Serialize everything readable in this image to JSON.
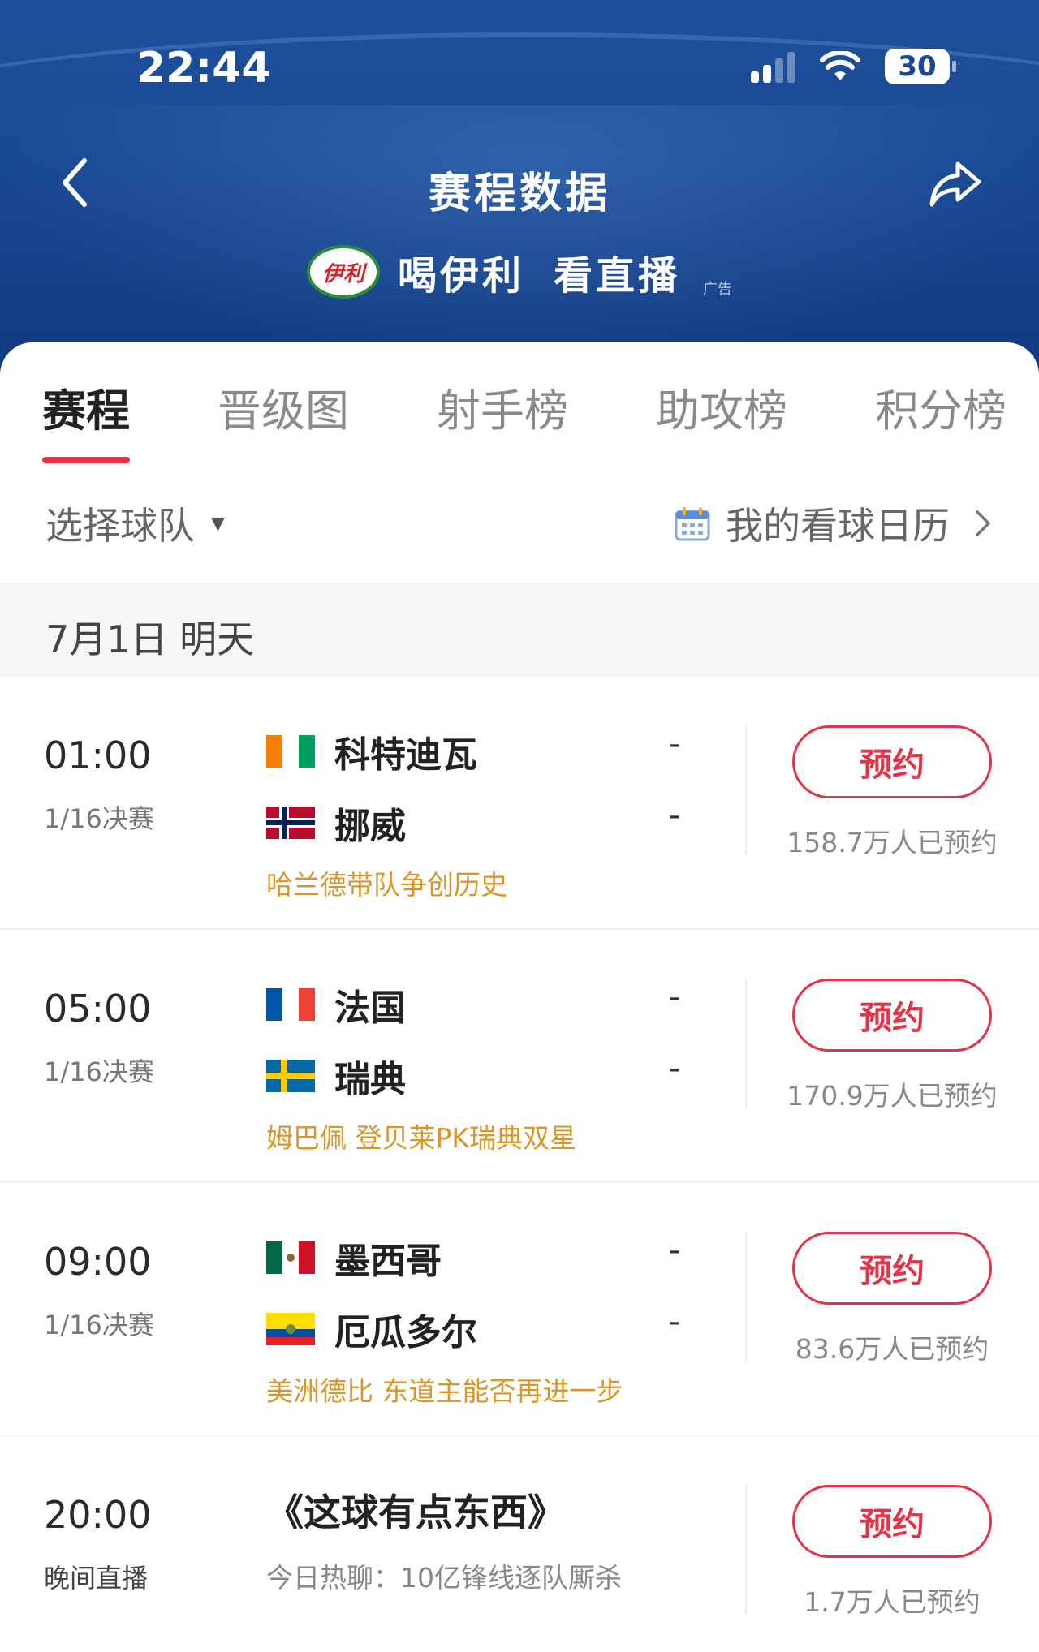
{
  "status_bar": {
    "time": "22:44",
    "battery": "30"
  },
  "nav": {
    "title": "赛程数据"
  },
  "ad": {
    "logo_text": "伊利",
    "text1": "喝伊利",
    "text2": "看直播",
    "tag": "广告"
  },
  "tabs": [
    {
      "label": "赛程",
      "active": true
    },
    {
      "label": "晋级图"
    },
    {
      "label": "射手榜"
    },
    {
      "label": "助攻榜"
    },
    {
      "label": "积分榜"
    }
  ],
  "filter": {
    "team_select": "选择球队",
    "calendar_label": "我的看球日历"
  },
  "date_header": "7月1日 明天",
  "matches": [
    {
      "time": "01:00",
      "stage": "1/16决赛",
      "home": "科特迪瓦",
      "away": "挪威",
      "home_score": "-",
      "away_score": "-",
      "note": "哈兰德带队争创历史",
      "reserve_label": "预约",
      "reserve_count": "158.7万人已预约"
    },
    {
      "time": "05:00",
      "stage": "1/16决赛",
      "home": "法国",
      "away": "瑞典",
      "home_score": "-",
      "away_score": "-",
      "note": "姆巴佩 登贝莱PK瑞典双星",
      "reserve_label": "预约",
      "reserve_count": "170.9万人已预约"
    },
    {
      "time": "09:00",
      "stage": "1/16决赛",
      "home": "墨西哥",
      "away": "厄瓜多尔",
      "home_score": "-",
      "away_score": "-",
      "note": "美洲德比 东道主能否再进一步",
      "reserve_label": "预约",
      "reserve_count": "83.6万人已预约"
    }
  ],
  "show": {
    "time": "20:00",
    "type": "晚间直播",
    "title": "《这球有点东西》",
    "subtitle": "今日热聊：10亿锋线逐队厮杀",
    "reserve_label": "预约",
    "reserve_count": "1.7万人已预约"
  },
  "colors": {
    "accent": "#e63246",
    "header_blue": "#1a4a94",
    "note_orange": "#d9962a"
  }
}
